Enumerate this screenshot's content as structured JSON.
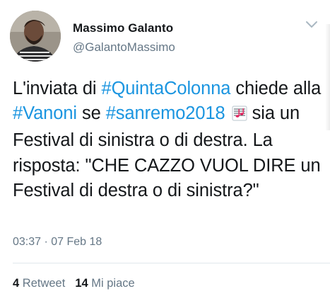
{
  "author": {
    "name": "Massimo Galanto",
    "handle": "@GalantoMassimo",
    "avatar_icon": "profile-photo"
  },
  "tweet": {
    "segments": [
      {
        "text": "L'inviata di ",
        "type": "text"
      },
      {
        "text": "#QuintaColonna",
        "type": "hashtag"
      },
      {
        "text": " chiede alla ",
        "type": "text"
      },
      {
        "text": "#Vanoni",
        "type": "hashtag"
      },
      {
        "text": " se ",
        "type": "text"
      },
      {
        "text": "#sanremo2018",
        "type": "hashtag"
      },
      {
        "text": " ",
        "type": "text"
      },
      {
        "text": " sia un Festival di sinistra o di destra. La risposta: \"CHE CAZZO VUOL DIRE un Festival di destra o di sinistra?\"",
        "type": "text"
      }
    ],
    "emoji_icon": "musical-score-icon",
    "timestamp": "03:37 · 07 Feb 18"
  },
  "stats": {
    "retweets_count": "4",
    "retweets_label": "Retweet",
    "likes_count": "14",
    "likes_label": "Mi piace"
  },
  "colors": {
    "hashtag": "#1b95e0",
    "secondary_text": "#657786",
    "primary_text": "#14171a",
    "divider": "#e1e8ed"
  }
}
